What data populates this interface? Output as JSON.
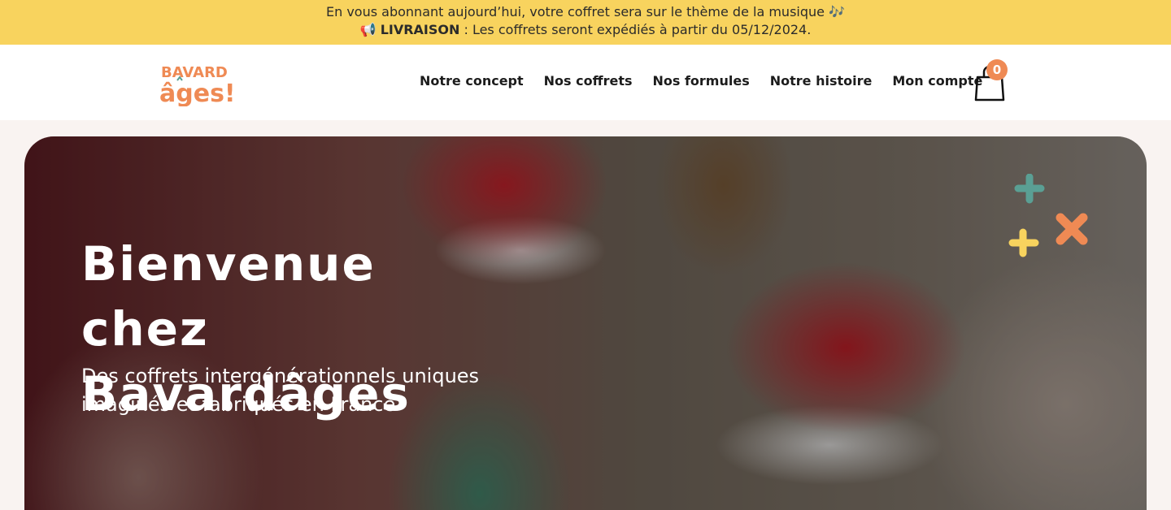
{
  "announcement": {
    "line1": "En vous abonnant aujourd’hui, votre coffret sera sur le thème de la musique 🎶",
    "line2_prefix": "📢",
    "line2_bold": "LIVRAISON",
    "line2_rest": " : Les coffrets seront expédiés à partir du 05/12/2024."
  },
  "brand": {
    "logo_text_top": "BAVARD",
    "logo_text_bottom": "âges!",
    "colors": {
      "accent_orange": "#ef8a54",
      "accent_yellow": "#f8d35e",
      "accent_teal": "#5a9f94"
    }
  },
  "nav": {
    "items": [
      {
        "label": "Notre concept"
      },
      {
        "label": "Nos coffrets"
      },
      {
        "label": "Nos formules"
      },
      {
        "label": "Notre histoire"
      },
      {
        "label": "Mon compte"
      }
    ]
  },
  "cart": {
    "icon": "shopping-bag-icon",
    "count": "0"
  },
  "hero": {
    "title": "Bienvenue chez Bavardâges",
    "subtitle": "Des coffrets intergénérationnels uniques imaginés et fabriqués en France"
  }
}
